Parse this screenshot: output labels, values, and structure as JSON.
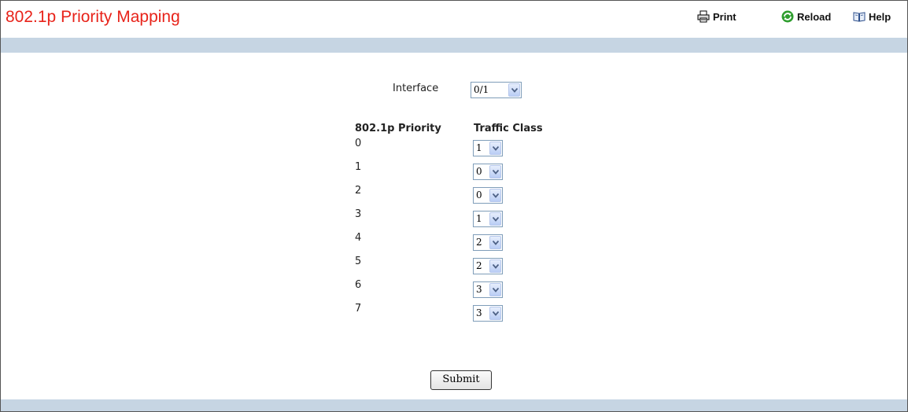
{
  "page": {
    "title": "802.1p Priority Mapping"
  },
  "toolbar": {
    "print_label": "Print",
    "reload_label": "Reload",
    "help_label": "Help"
  },
  "interface": {
    "label": "Interface",
    "selected": "0/1"
  },
  "table": {
    "col_priority": "802.1p Priority",
    "col_traffic_class": "Traffic Class",
    "rows": [
      {
        "priority": "0",
        "traffic_class": "1"
      },
      {
        "priority": "1",
        "traffic_class": "0"
      },
      {
        "priority": "2",
        "traffic_class": "0"
      },
      {
        "priority": "3",
        "traffic_class": "1"
      },
      {
        "priority": "4",
        "traffic_class": "2"
      },
      {
        "priority": "5",
        "traffic_class": "2"
      },
      {
        "priority": "6",
        "traffic_class": "3"
      },
      {
        "priority": "7",
        "traffic_class": "3"
      }
    ]
  },
  "form": {
    "submit_label": "Submit"
  },
  "colors": {
    "title": "#e8231a",
    "band": "#c6d5e3",
    "select_border": "#7f9db9"
  },
  "icons": [
    "printer-icon",
    "reload-icon",
    "help-book-icon",
    "chevron-down-icon"
  ]
}
